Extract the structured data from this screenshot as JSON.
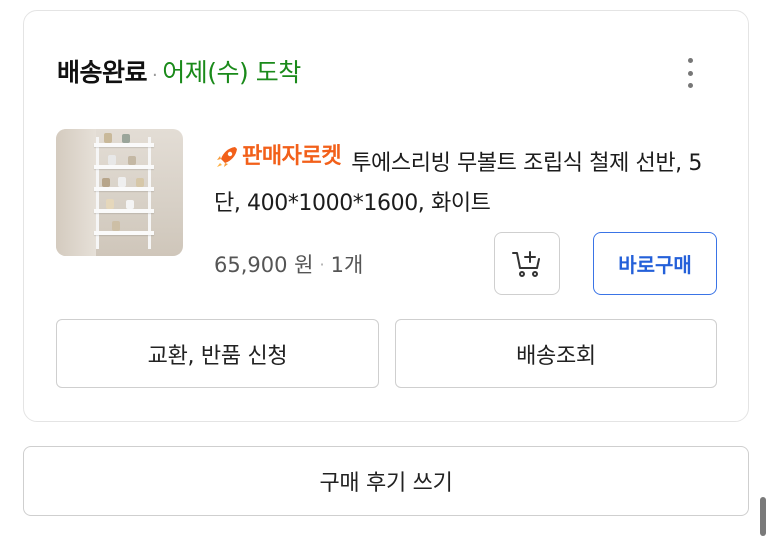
{
  "order": {
    "status": "배송완료",
    "separator": "·",
    "arrival": "어제(수) 도착"
  },
  "product": {
    "badge": "판매자로켓",
    "name": "투에스리빙 무볼트 조립식 철제 선반, 5단, 400*1000*1600, 화이트",
    "price": "65,900 원",
    "quantity": "1개"
  },
  "buttons": {
    "buy_now": "바로구매",
    "exchange_return": "교환, 반품 신청",
    "track_delivery": "배송조회",
    "write_review": "구매 후기 쓰기"
  },
  "icons": {
    "more": "more-vertical-icon",
    "cart": "add-to-cart-icon",
    "rocket": "rocket-icon"
  },
  "colors": {
    "arrival_green": "#1a8a1a",
    "rocket_orange": "#f2601a",
    "buy_blue": "#2460d9"
  }
}
